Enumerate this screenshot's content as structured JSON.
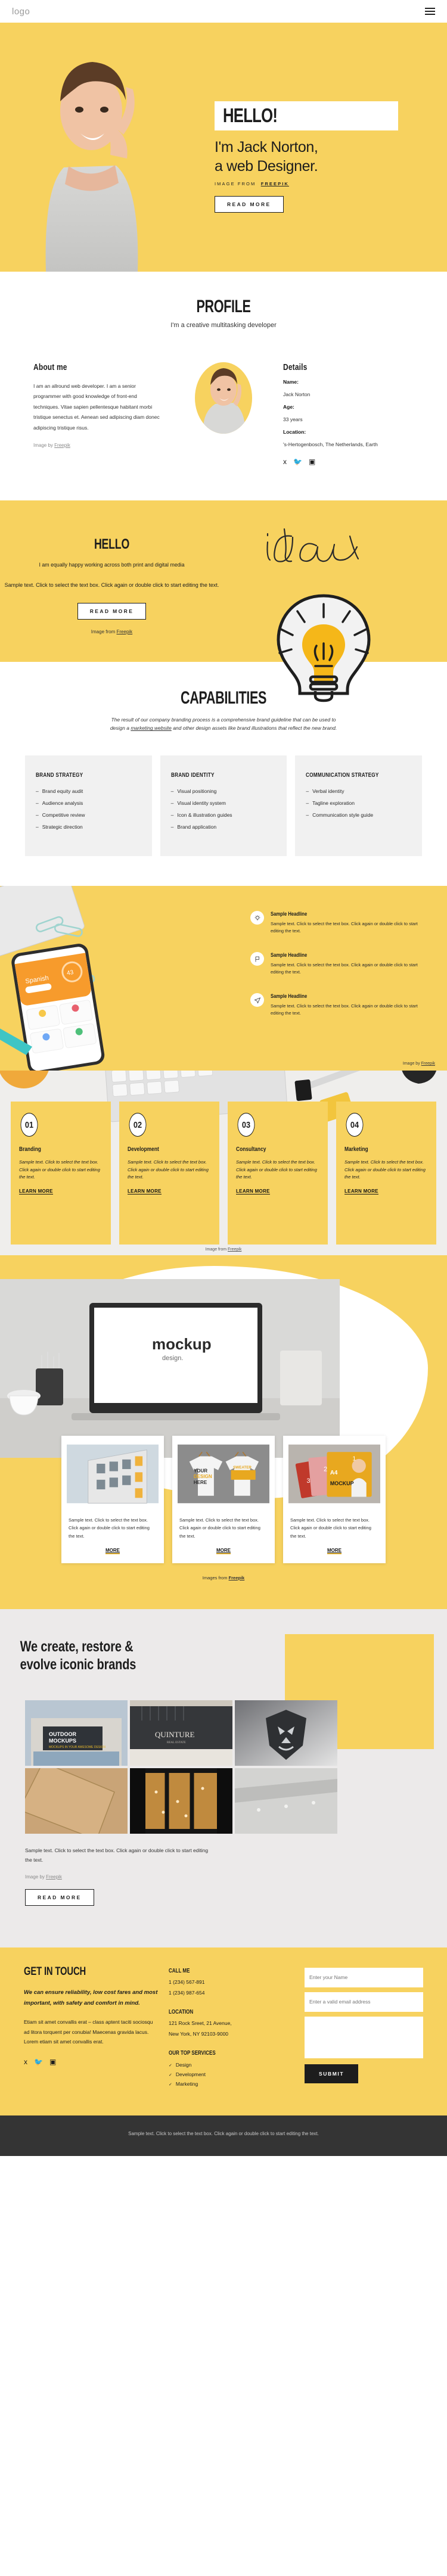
{
  "header": {
    "logo": "logo",
    "menu_icon": "hamburger-icon"
  },
  "hero": {
    "hello": "HELLO!",
    "title_line1": "I'm Jack Norton,",
    "title_line2": "a web Designer.",
    "credit_prefix": "IMAGE FROM",
    "credit_link": "FREEPIK",
    "button": "READ MORE"
  },
  "profile": {
    "title": "PROFILE",
    "subtitle": "I'm a creative multitasking developer",
    "about_title": "About me",
    "about_text": "I am an allround web developer. I am a senior programmer with good knowledge of front-end techniques. Vitae sapien pellentesque habitant morbi tristique senectus et. Aenean sed adipiscing diam donec adipiscing tristique risus.",
    "image_credit_prefix": "Image by",
    "image_credit_link": "Freepik",
    "details_title": "Details",
    "details": [
      {
        "label": "Name:",
        "value": "Jack Norton"
      },
      {
        "label": "Age:",
        "value": "33 years"
      },
      {
        "label": "Location:",
        "value": "'s-Hertogenbosch, The Netherlands, Earth"
      }
    ],
    "socials": [
      "facebook-icon",
      "twitter-icon",
      "instagram-icon"
    ]
  },
  "idea": {
    "title": "HELLO",
    "lead": "I am equally happy working across both print and digital media",
    "sample": "Sample text. Click to select the text box. Click again or double click to start editing the text.",
    "button": "READ MORE",
    "credit_prefix": "Image from",
    "credit_link": "Freepik",
    "word": "idea"
  },
  "capabilities": {
    "title": "CAPABILITIES",
    "intro_a": "The result of our company branding process is a comprehensive brand guideline that can be used to design a ",
    "intro_link": "marketing website",
    "intro_b": " and other design assets like brand illustrations that reflect the new brand.",
    "cards": [
      {
        "title": "BRAND STRATEGY",
        "items": [
          "Brand equity audit",
          "Audience analysis",
          "Competitive review",
          "Strategic direction"
        ]
      },
      {
        "title": "BRAND IDENTITY",
        "items": [
          "Visual positioning",
          "Visual identity system",
          "Icon & illustration guides",
          "Brand application"
        ]
      },
      {
        "title": "COMMUNICATION STRATEGY",
        "items": [
          "Verbal identity",
          "Tagline exploration",
          "Communication style guide"
        ]
      }
    ]
  },
  "features": {
    "items": [
      {
        "icon": "lightbulb-icon",
        "headline": "Sample Headline",
        "text": "Sample text. Click to select the text box. Click again or double click to start editing the text."
      },
      {
        "icon": "flag-icon",
        "headline": "Sample Headline",
        "text": "Sample text. Click to select the text box. Click again or double click to start editing the text."
      },
      {
        "icon": "paper-plane-icon",
        "headline": "Sample Headline",
        "text": "Sample text. Click to select the text box. Click again or double click to start editing the text."
      }
    ],
    "credit_prefix": "Image by",
    "credit_link": "Freepik"
  },
  "steps": {
    "items": [
      {
        "num": "01",
        "title": "Branding",
        "text": "Sample text. Click to select the text box. Click again or double click to start editing the text.",
        "link": "LEARN MORE"
      },
      {
        "num": "02",
        "title": "Development",
        "text": "Sample text. Click to select the text box. Click again or double click to start editing the text.",
        "link": "LEARN MORE"
      },
      {
        "num": "03",
        "title": "Consultancy",
        "text": "Sample text. Click to select the text box. Click again or double click to start editing the text.",
        "link": "LEARN MORE"
      },
      {
        "num": "04",
        "title": "Marketing",
        "text": "Sample text. Click to select the text box. Click again or double click to start editing the text.",
        "link": "LEARN MORE"
      }
    ],
    "credit_prefix": "Image from",
    "credit_link": "Freepik"
  },
  "showcase": {
    "mockup_word": "mockup",
    "mockup_sub": "design.",
    "cards": [
      {
        "text": "Sample text. Click to select the text box. Click again or double click to start editing the text.",
        "link": "MORE"
      },
      {
        "text": "Sample text. Click to select the text box. Click again or double click to start editing the text.",
        "link": "MORE"
      },
      {
        "text": "Sample text. Click to select the text box. Click again or double click to start editing the text.",
        "link": "MORE"
      }
    ],
    "credit_prefix": "Images from",
    "credit_link": "Freepik"
  },
  "brands": {
    "title_line1": "We create, restore &",
    "title_line2": "evolve iconic brands",
    "sample": "Sample text. Click to select the text box. Click again or double click to start editing the text.",
    "credit_prefix": "Image by",
    "credit_link": "Freepik",
    "button": "READ MORE",
    "tiles": [
      "OUTDOOR MOCKUPS",
      "QUINTURE",
      "lion-logo",
      "kraft-paper",
      "storefront",
      "ceiling"
    ]
  },
  "contact": {
    "title": "GET IN TOUCH",
    "strong": "We can ensure reliability, low cost fares and most important, with safety and comfort in mind.",
    "body": "Etiam sit amet convallis erat – class aptent taciti sociosqu ad litora torquent per conubia! Maecenas gravida lacus. Lorem etiam sit amet convallis erat.",
    "socials": [
      "facebook-icon",
      "twitter-icon",
      "instagram-icon"
    ],
    "call_title": "CALL ME",
    "phones": [
      "1 (234) 567-891",
      "1 (234) 987-654"
    ],
    "location_title": "LOCATION",
    "address_line1": "121 Rock Sreet, 21 Avenue,",
    "address_line2": "New York, NY 92103-9000",
    "services_title": "OUR TOP SERVICES",
    "services": [
      "Design",
      "Development",
      "Marketing"
    ],
    "name_placeholder": "Enter your Name",
    "email_placeholder": "Enter a valid email address",
    "message_placeholder": "",
    "submit": "SUBMIT"
  },
  "bottom": {
    "text": "Sample text. Click to select the text box. Click again or double click to start editing the text."
  },
  "colors": {
    "accent": "#f7d25f",
    "dark": "#1d1d1d",
    "bottom_bar": "#343434",
    "grey": "#eceaea"
  }
}
